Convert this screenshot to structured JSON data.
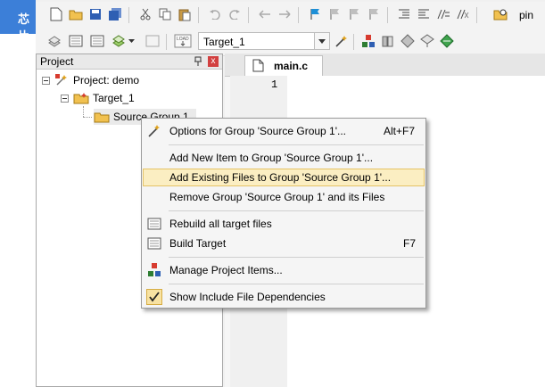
{
  "app": {
    "left_banner_text": "芯片",
    "toolbar_right_label": "pin",
    "target_select_value": "Target_1"
  },
  "project_panel": {
    "title": "Project",
    "close_label": "x",
    "tree": [
      {
        "label": "Project: demo"
      },
      {
        "label": "Target_1"
      },
      {
        "label": "Source Group 1"
      }
    ]
  },
  "editor": {
    "tab_label": "main.c",
    "line_numbers": [
      "1"
    ]
  },
  "context_menu": {
    "items": [
      {
        "label": "Options for Group 'Source Group 1'...",
        "shortcut": "Alt+F7",
        "icon": "options-icon"
      },
      {
        "label": "Add New  Item to Group 'Source Group 1'...",
        "shortcut": "",
        "icon": ""
      },
      {
        "label": "Add Existing Files to Group 'Source Group 1'...",
        "shortcut": "",
        "icon": "",
        "highlighted": true
      },
      {
        "label": "Remove Group 'Source Group 1' and its Files",
        "shortcut": "",
        "icon": ""
      },
      {
        "label": "Rebuild all target files",
        "shortcut": "",
        "icon": "rebuild-icon"
      },
      {
        "label": "Build Target",
        "shortcut": "F7",
        "icon": "build-icon"
      },
      {
        "label": "Manage Project Items...",
        "shortcut": "",
        "icon": "manage-items-icon"
      },
      {
        "label": "Show Include File Dependencies",
        "shortcut": "",
        "icon": "checkmark-icon",
        "checked": true
      }
    ]
  },
  "colors": {
    "banner_blue": "#3c7fd8",
    "menu_highlight": "#fbeec2",
    "menu_highlight_border": "#e5c365"
  }
}
